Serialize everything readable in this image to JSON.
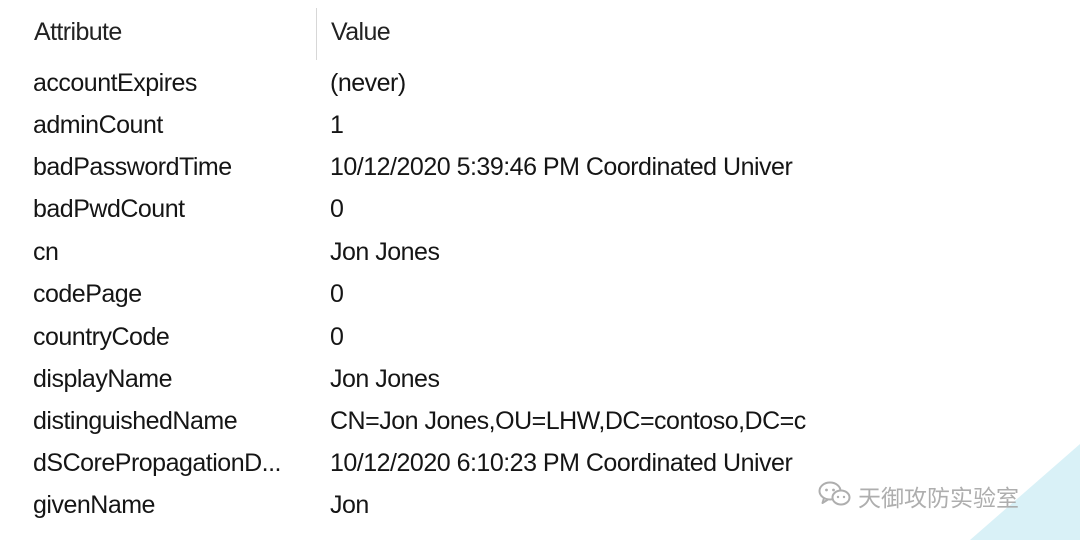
{
  "header": {
    "attribute_label": "Attribute",
    "value_label": "Value"
  },
  "rows": [
    {
      "attribute": "accountExpires",
      "value": "(never)"
    },
    {
      "attribute": "adminCount",
      "value": "1"
    },
    {
      "attribute": "badPasswordTime",
      "value": "10/12/2020 5:39:46 PM Coordinated Univer"
    },
    {
      "attribute": "badPwdCount",
      "value": "0"
    },
    {
      "attribute": "cn",
      "value": "Jon Jones"
    },
    {
      "attribute": "codePage",
      "value": "0"
    },
    {
      "attribute": "countryCode",
      "value": "0"
    },
    {
      "attribute": "displayName",
      "value": "Jon Jones"
    },
    {
      "attribute": "distinguishedName",
      "value": "CN=Jon Jones,OU=LHW,DC=contoso,DC=c"
    },
    {
      "attribute": "dSCorePropagationD...",
      "value": "10/12/2020 6:10:23 PM Coordinated Univer"
    },
    {
      "attribute": "givenName",
      "value": "Jon"
    }
  ],
  "watermark": {
    "icon": "wechat-icon",
    "text": "天御攻防实验室"
  },
  "colors": {
    "corner_accent": "#d9f1f7",
    "watermark": "#a6a6a6"
  }
}
